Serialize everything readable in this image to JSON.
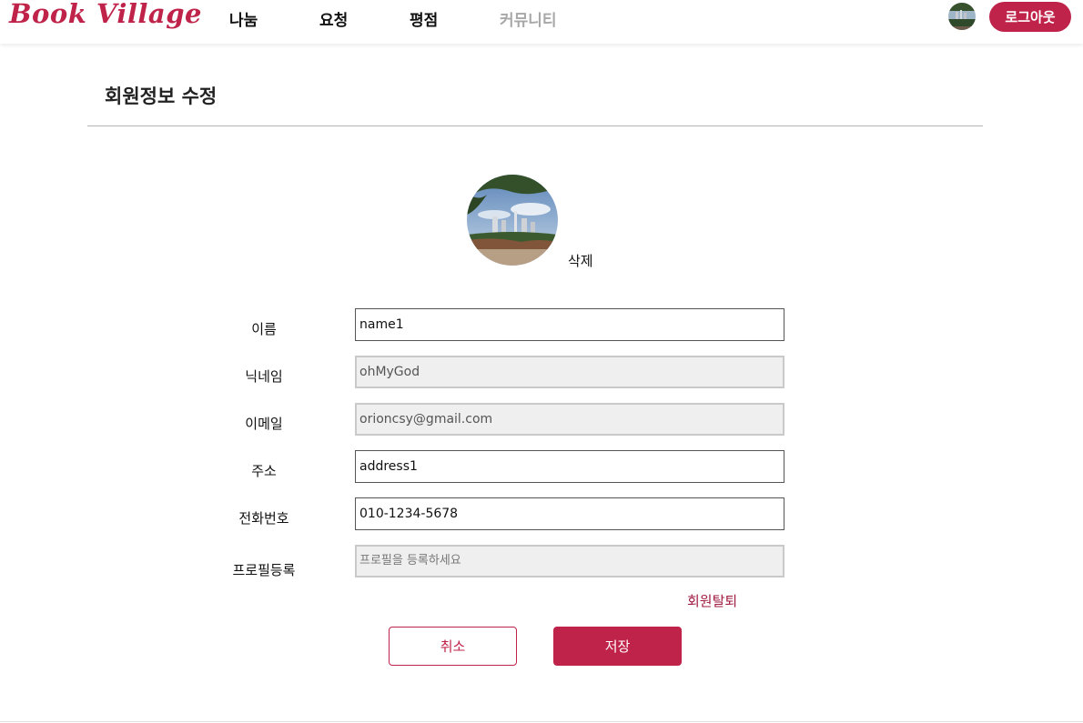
{
  "header": {
    "logo": "Book Village",
    "nav": [
      "나눔",
      "요청",
      "평점",
      "커뮤니티"
    ],
    "logout_label": "로그아웃"
  },
  "page": {
    "title": "회원정보 수정"
  },
  "profile": {
    "delete_label": "삭제"
  },
  "form": {
    "name_label": "이름",
    "name_value": "name1",
    "nickname_label": "닉네임",
    "nickname_value": "ohMyGod",
    "email_label": "이메일",
    "email_value": "orioncsy@gmail.com",
    "address_label": "주소",
    "address_value": "address1",
    "phone_label": "전화번호",
    "phone_value": "010-1234-5678",
    "profile_label": "프로필등록",
    "profile_placeholder": "프로필을 등록하세요"
  },
  "actions": {
    "withdraw_label": "회원탈퇴",
    "cancel_label": "취소",
    "save_label": "저장"
  },
  "colors": {
    "brand": "#c0234a",
    "withdraw_text": "#a0193f",
    "readonly_bg": "#efefef"
  },
  "icons": {
    "avatar": "avatar-photo-icon"
  }
}
